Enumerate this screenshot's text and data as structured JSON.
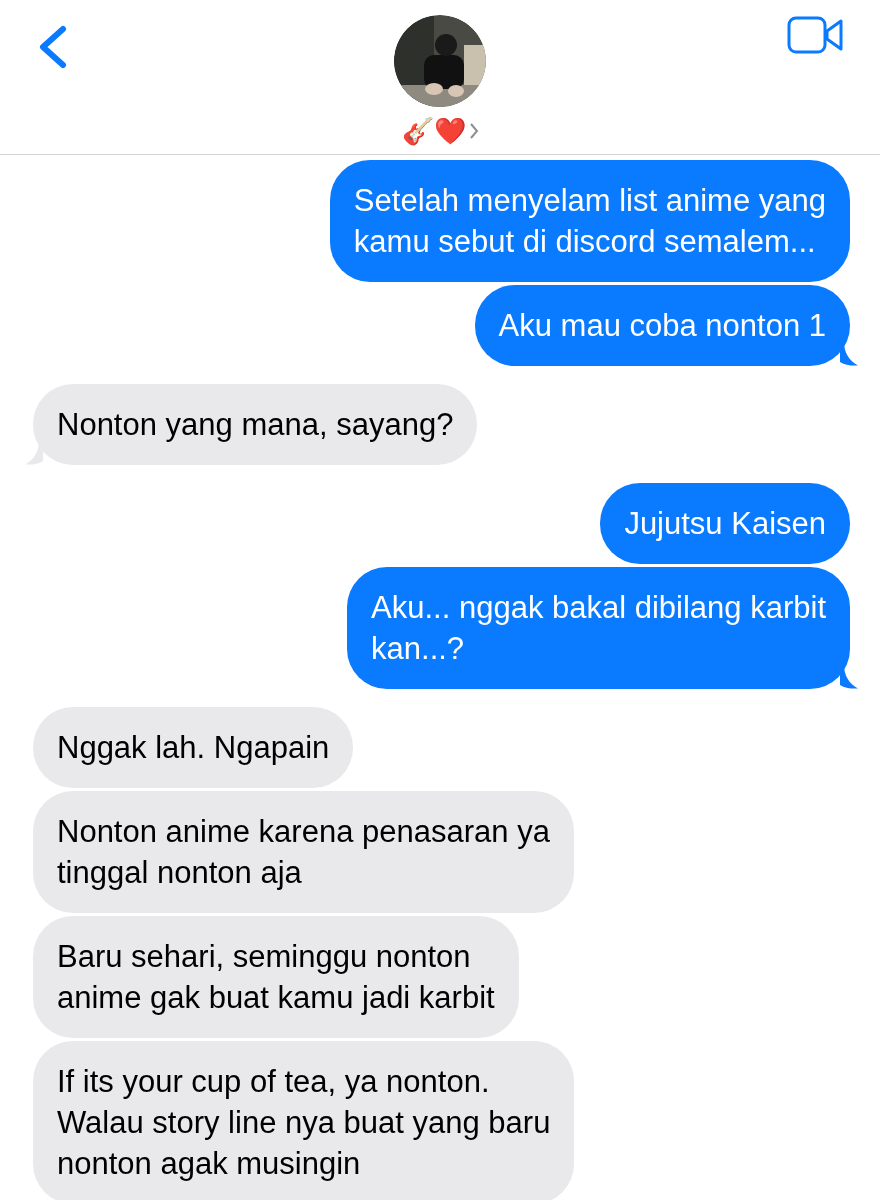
{
  "header": {
    "contact_name": "🎸❤️"
  },
  "messages": [
    {
      "kind": "sent",
      "tail": false,
      "lines": [
        "Setelah menyelam list anime yang",
        "kamu sebut di discord semalem..."
      ]
    },
    {
      "kind": "sent",
      "tail": true,
      "lines": [
        "Aku mau coba nonton 1"
      ]
    },
    {
      "kind": "received",
      "tail": true,
      "lines": [
        "Nonton yang mana, sayang?"
      ]
    },
    {
      "kind": "sent",
      "tail": false,
      "lines": [
        "Jujutsu Kaisen"
      ]
    },
    {
      "kind": "sent",
      "tail": true,
      "lines": [
        "Aku... nggak bakal dibilang karbit",
        "kan...?"
      ]
    },
    {
      "kind": "received",
      "tail": false,
      "lines": [
        "Nggak lah. Ngapain"
      ]
    },
    {
      "kind": "received",
      "tail": false,
      "lines": [
        "Nonton anime karena penasaran ya",
        "tinggal nonton aja"
      ]
    },
    {
      "kind": "received",
      "tail": false,
      "lines": [
        "Baru sehari, seminggu nonton",
        "anime gak buat kamu jadi karbit"
      ]
    },
    {
      "kind": "received",
      "tail": false,
      "lines": [
        "If its your cup of tea, ya nonton.",
        "Walau story line nya buat yang baru",
        "nonton agak musingin"
      ]
    }
  ]
}
